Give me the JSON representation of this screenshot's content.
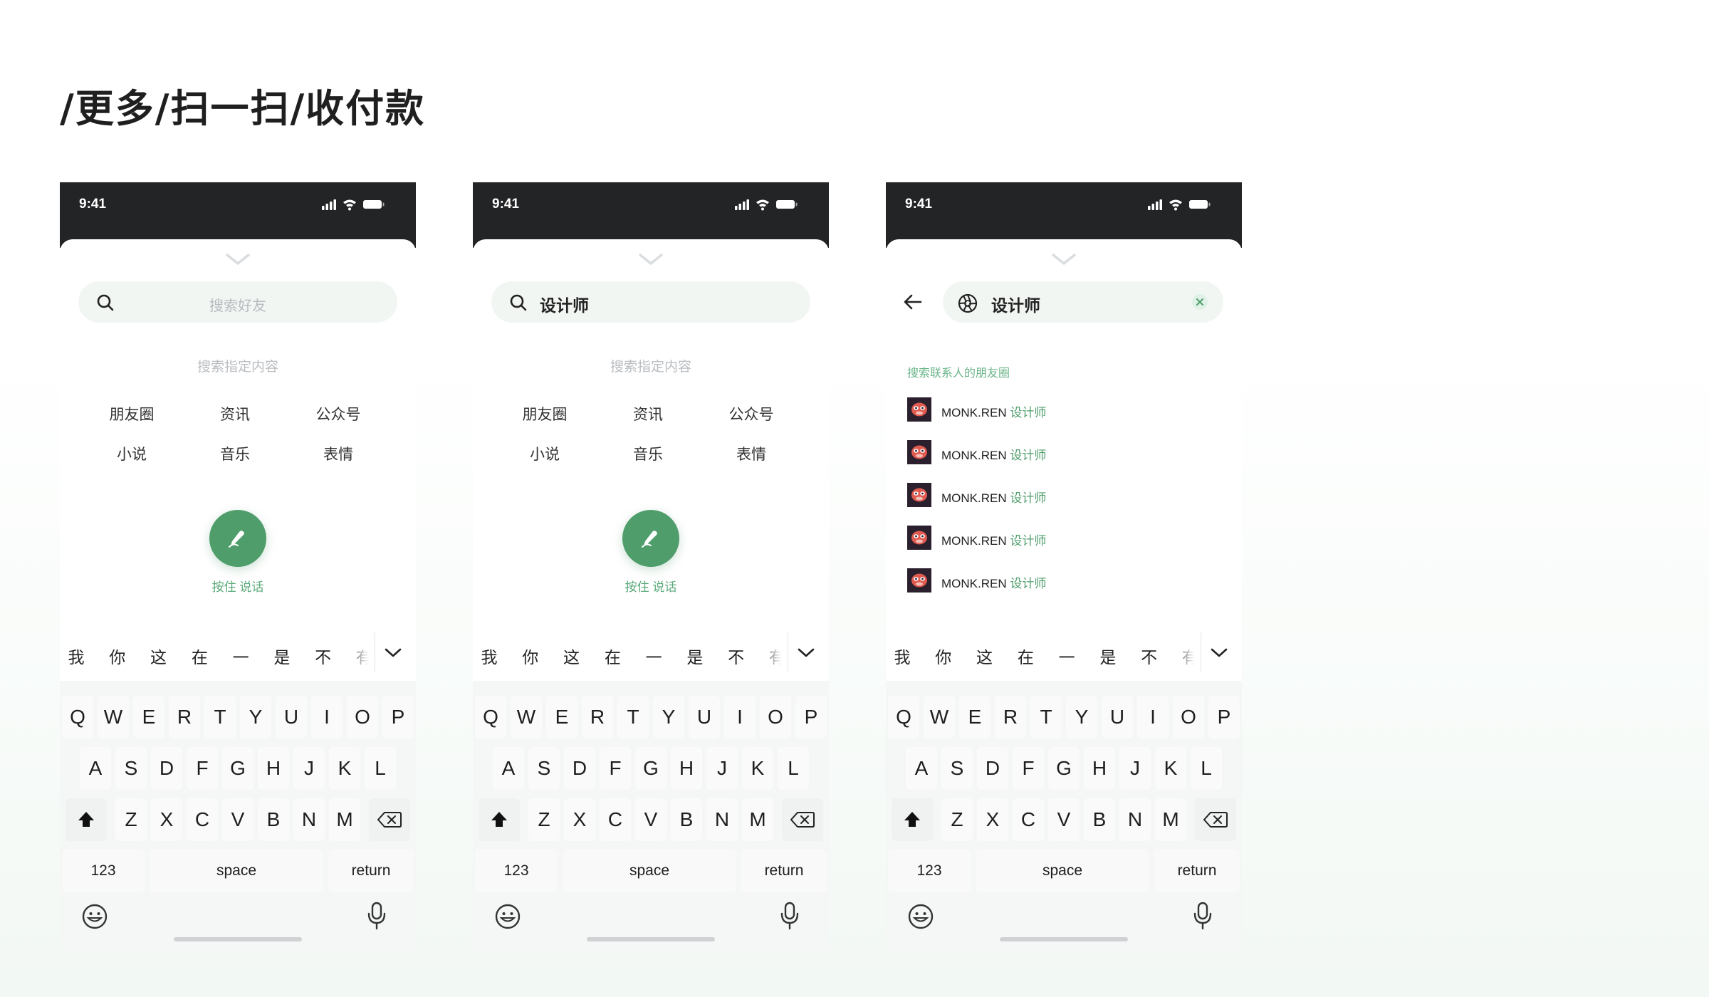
{
  "page_title": "/更多/扫一扫/收付款",
  "status": {
    "time": "9:41"
  },
  "search": {
    "placeholder": "搜索好友",
    "query": "设计师",
    "hint": "搜索指定内容"
  },
  "categories": [
    "朋友圈",
    "资讯",
    "公众号",
    "小说",
    "音乐",
    "表情"
  ],
  "voice": {
    "label": "按住 说话"
  },
  "results": {
    "section_title": "搜索联系人的朋友圈",
    "items": [
      {
        "name": "MONK.REN",
        "highlight": "设计师"
      },
      {
        "name": "MONK.REN",
        "highlight": "设计师"
      },
      {
        "name": "MONK.REN",
        "highlight": "设计师"
      },
      {
        "name": "MONK.REN",
        "highlight": "设计师"
      },
      {
        "name": "MONK.REN",
        "highlight": "设计师"
      }
    ]
  },
  "keyboard": {
    "candidates": [
      "我",
      "你",
      "这",
      "在",
      "一",
      "是",
      "不",
      "有"
    ],
    "row1": [
      "Q",
      "W",
      "E",
      "R",
      "T",
      "Y",
      "U",
      "I",
      "O",
      "P"
    ],
    "row2": [
      "A",
      "S",
      "D",
      "F",
      "G",
      "H",
      "J",
      "K",
      "L"
    ],
    "row3": [
      "Z",
      "X",
      "C",
      "V",
      "B",
      "N",
      "M"
    ],
    "numbers_label": "123",
    "space_label": "space",
    "return_label": "return"
  },
  "colors": {
    "accent": "#4e9d6b",
    "status_bar": "#232426"
  }
}
